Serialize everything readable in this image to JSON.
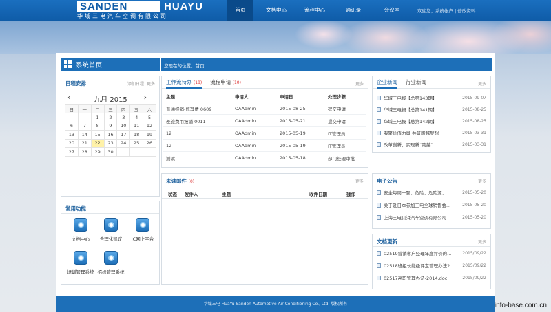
{
  "brand": {
    "logo_left": "SANDEN",
    "logo_right": "HUAYU",
    "company_cn": "华域三电汽车空调有限公司"
  },
  "nav": {
    "items": [
      "首页",
      "文档中心",
      "流程中心",
      "通讯录",
      "会议室"
    ],
    "welcome": "欢迎您，系统帐户 | 修改资料"
  },
  "header": {
    "title": "系统首页",
    "location": "您现在的位置：首页"
  },
  "calendar": {
    "title": "日程安排",
    "add": "添加日程",
    "more": "更多",
    "month_label": "九月 2015",
    "weekdays": [
      "日",
      "一",
      "二",
      "三",
      "四",
      "五",
      "六"
    ],
    "weeks": [
      [
        "",
        "",
        "1",
        "2",
        "3",
        "4",
        "5"
      ],
      [
        "6",
        "7",
        "8",
        "9",
        "10",
        "11",
        "12"
      ],
      [
        "13",
        "14",
        "15",
        "16",
        "17",
        "18",
        "19"
      ],
      [
        "20",
        "21",
        "22",
        "23",
        "24",
        "25",
        "26"
      ],
      [
        "27",
        "28",
        "29",
        "30",
        "",
        "",
        ""
      ]
    ],
    "today": "22"
  },
  "quick": {
    "title": "常用功能",
    "items": [
      "文档中心",
      "合理化建议",
      "IC网上平台",
      "培训管理系统",
      "招标管理系统"
    ]
  },
  "workflow": {
    "tabs": [
      {
        "label": "工作流待办",
        "count": "(18)"
      },
      {
        "label": "流程申请",
        "count": "(10)"
      }
    ],
    "more": "更多",
    "columns": [
      "主题",
      "申请人",
      "申请日",
      "处理步骤"
    ],
    "rows": [
      [
        "普通报销-修理费 0609",
        "OAAdmin",
        "2015-08-25",
        "提交申请"
      ],
      [
        "差旅费用报销 0011",
        "OAAdmin",
        "2015-05-21",
        "提交申请"
      ],
      [
        "12",
        "OAAdmin",
        "2015-05-19",
        "IT管理员"
      ],
      [
        "12",
        "OAAdmin",
        "2015-05-19",
        "IT管理员"
      ],
      [
        "测试",
        "OAAdmin",
        "2015-05-18",
        "部门经理审批"
      ]
    ]
  },
  "mail": {
    "title": "未读邮件",
    "count": "(0)",
    "more": "更多",
    "columns": [
      "状态",
      "发件人",
      "主题",
      "收件日期",
      "操作"
    ]
  },
  "news": {
    "tabs": [
      "企业新闻",
      "行业新闻"
    ],
    "more": "更多",
    "items": [
      {
        "title": "华域三电报【总第143期】",
        "date": "2015-09-07"
      },
      {
        "title": "华域三电报【总第141期】",
        "date": "2015-08-25"
      },
      {
        "title": "华域三电报【总第142期】",
        "date": "2015-08-25"
      },
      {
        "title": "凝聚价值力量 共筑腾越梦想",
        "date": "2015-03-31"
      },
      {
        "title": "改革创新，实现新“跨越”",
        "date": "2015-03-31"
      }
    ]
  },
  "notice": {
    "title": "电子公告",
    "more": "更多",
    "items": [
      {
        "title": "安全每周一题：危险、危险源、...",
        "date": "2015-05-20"
      },
      {
        "title": "关于赴日本参加三电全球销售会...",
        "date": "2015-05-20"
      },
      {
        "title": "上海三电贝洱汽车空调有限公司...",
        "date": "2015-05-20"
      }
    ]
  },
  "docs": {
    "title": "文档更新",
    "more": "更多",
    "items": [
      {
        "title": "02519营销客户经理年度评价的...",
        "date": "2015/09/22"
      },
      {
        "title": "02518班组长能级评定管理办法2...",
        "date": "2015/09/22"
      },
      {
        "title": "02517高职管理办法-2014.doc",
        "date": "2015/09/22"
      }
    ]
  },
  "footer": {
    "text": "华域三电 HuaYu Sanden Automotive Air Conditioning Co., Ltd. 版权所有"
  },
  "watermark": "info-base.com.cn",
  "colors": {
    "primary": "#1d6fb8",
    "nav_active": "#0a4a8a",
    "today_bg": "#fff2a8",
    "count_red": "#d33333"
  }
}
